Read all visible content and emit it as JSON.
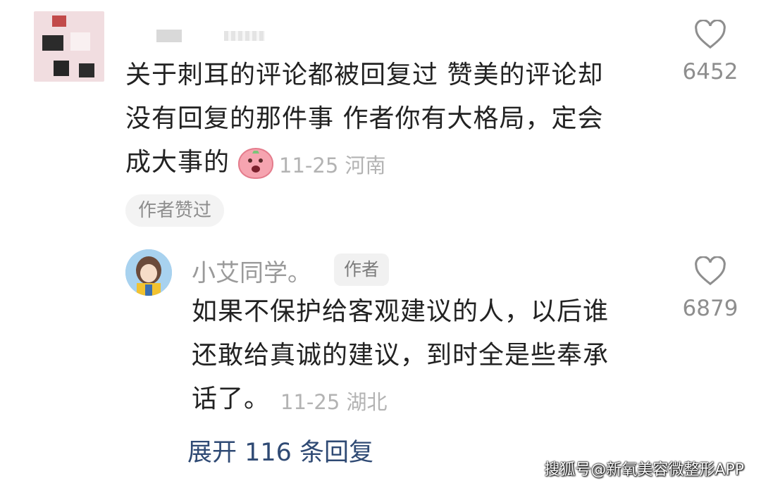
{
  "comment": {
    "lines": [
      "关于刺耳的评论都被回复过 赞美的评论却",
      "没有回复的那件事 作者你有大格局，定会",
      "成大事的"
    ],
    "emoji": "angry-face-emoji",
    "date": "11-25",
    "location": "河南",
    "like_count": "6452",
    "author_liked_label": "作者赞过"
  },
  "reply": {
    "username": "小艾同学。",
    "author_tag": "作者",
    "lines": [
      "如果不保护给客观建议的人，以后谁",
      "还敢给真诚的建议，到时全是些奉承",
      "话了。"
    ],
    "date": "11-25",
    "location": "湖北",
    "like_count": "6879"
  },
  "expand_replies": "展开 116 条回复",
  "watermark": "搜狐号@新氧美容微整形APP",
  "colors": {
    "text": "#222222",
    "meta": "#b3b3b3",
    "link": "#2f4a74",
    "chip_bg": "#f3f3f3"
  }
}
